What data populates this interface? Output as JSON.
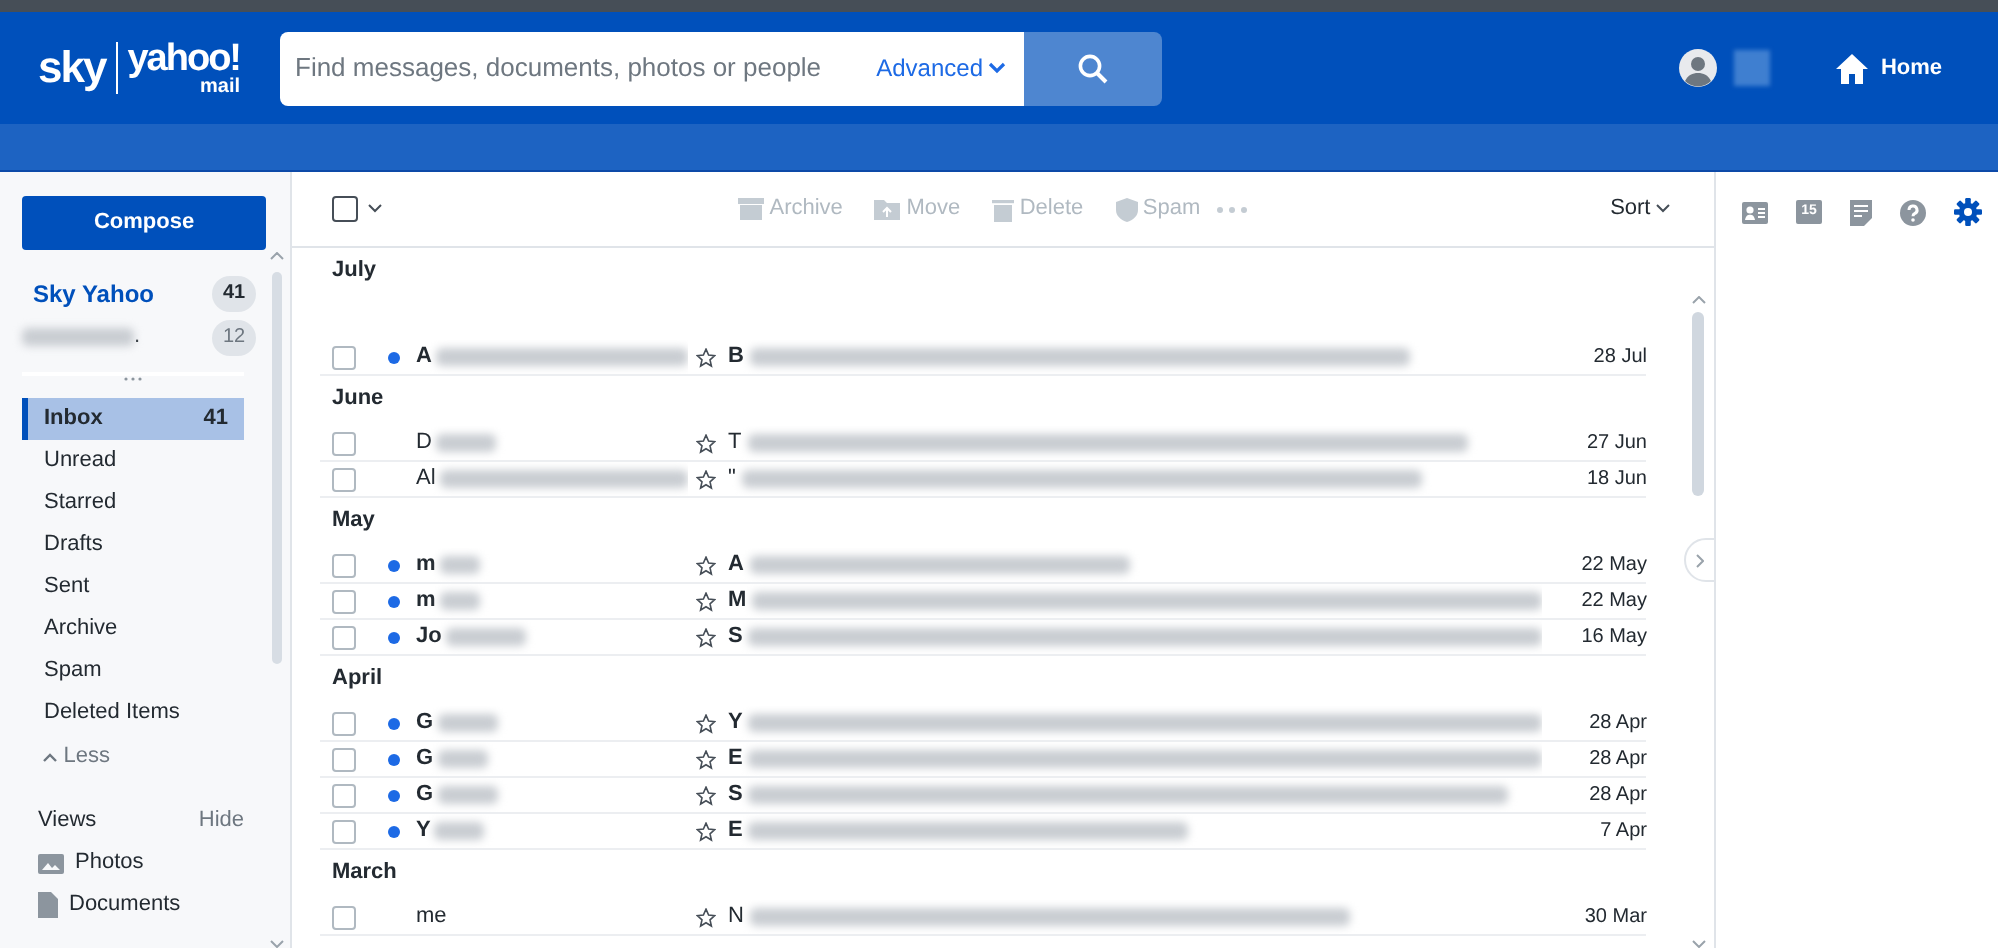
{
  "header": {
    "logo": {
      "brand": "sky",
      "product": "yahoo!",
      "sub": "mail"
    },
    "search": {
      "placeholder": "Find messages, documents, photos or people",
      "advanced": "Advanced"
    },
    "home": "Home"
  },
  "sidebar": {
    "compose": "Compose",
    "accounts": [
      {
        "name": "Sky Yahoo",
        "count": "41",
        "redacted": false
      },
      {
        "name": ".",
        "count": "12",
        "redacted": true
      }
    ],
    "folders": [
      {
        "label": "Inbox",
        "count": "41",
        "selected": true
      },
      {
        "label": "Unread",
        "selected": false
      },
      {
        "label": "Starred",
        "selected": false
      },
      {
        "label": "Drafts",
        "selected": false
      },
      {
        "label": "Sent",
        "selected": false
      },
      {
        "label": "Archive",
        "selected": false
      },
      {
        "label": "Spam",
        "selected": false
      },
      {
        "label": "Deleted Items",
        "selected": false
      }
    ],
    "less": "Less",
    "views": {
      "title": "Views",
      "toggle": "Hide",
      "items": [
        {
          "label": "Photos",
          "kind": "photos"
        },
        {
          "label": "Documents",
          "kind": "documents"
        }
      ]
    }
  },
  "toolbar": {
    "select_all": {
      "checked": false
    },
    "actions": [
      {
        "label": "Archive",
        "kind": "archive",
        "disabled": true
      },
      {
        "label": "Move",
        "kind": "move",
        "disabled": true
      },
      {
        "label": "Delete",
        "kind": "delete",
        "disabled": true
      },
      {
        "label": "Spam",
        "kind": "spam",
        "disabled": true
      }
    ],
    "sort": "Sort"
  },
  "groups": [
    {
      "month": "July",
      "messages": [
        {
          "checked": false,
          "unread": true,
          "starred": false,
          "sender": "A",
          "subject": "B",
          "date": "28 Jul"
        }
      ]
    },
    {
      "month": "June",
      "messages": [
        {
          "checked": false,
          "unread": false,
          "starred": false,
          "sender": "D",
          "subject": "T",
          "date": "27 Jun"
        },
        {
          "checked": false,
          "unread": false,
          "starred": false,
          "sender": "Al",
          "subject": "\"",
          "date": "18 Jun"
        }
      ]
    },
    {
      "month": "May",
      "messages": [
        {
          "checked": false,
          "unread": true,
          "starred": false,
          "sender": "m",
          "subject": "A",
          "date": "22 May"
        },
        {
          "checked": false,
          "unread": true,
          "starred": false,
          "sender": "m",
          "subject": "M",
          "date": "22 May"
        },
        {
          "checked": false,
          "unread": true,
          "starred": false,
          "sender": "Jo",
          "subject": "S",
          "date": "16 May"
        }
      ]
    },
    {
      "month": "April",
      "messages": [
        {
          "checked": false,
          "unread": true,
          "starred": false,
          "sender": "G",
          "subject": "Y",
          "date": "28 Apr"
        },
        {
          "checked": false,
          "unread": true,
          "starred": false,
          "sender": "G",
          "subject": "E",
          "date": "28 Apr"
        },
        {
          "checked": false,
          "unread": true,
          "starred": false,
          "sender": "G",
          "subject": "S",
          "date": "28 Apr"
        },
        {
          "checked": false,
          "unread": true,
          "starred": false,
          "sender": "Y",
          "subject": "E",
          "date": "7 Apr"
        }
      ]
    },
    {
      "month": "March",
      "messages": [
        {
          "checked": false,
          "unread": false,
          "starred": false,
          "sender": "me",
          "subject": "N",
          "date": "30 Mar"
        }
      ]
    }
  ],
  "right_panel": {
    "calendar_day": "15",
    "tools": [
      {
        "kind": "contacts",
        "selected": false
      },
      {
        "kind": "calendar",
        "selected": false
      },
      {
        "kind": "notepad",
        "selected": false
      },
      {
        "kind": "help",
        "selected": false
      },
      {
        "kind": "settings",
        "selected": true
      }
    ]
  }
}
